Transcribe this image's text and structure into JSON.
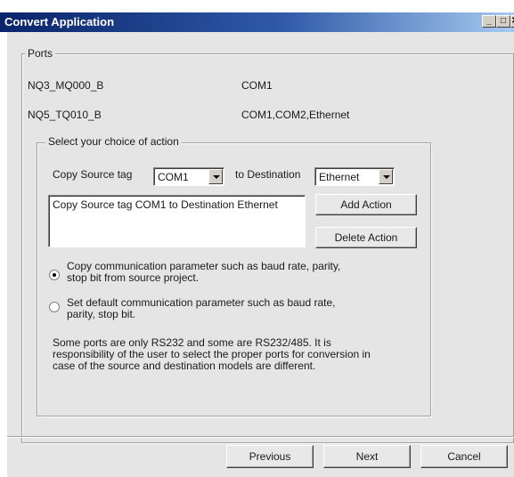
{
  "window": {
    "title": "Convert Application",
    "controls": {
      "minimize": "_",
      "maximize": "□",
      "close": "✕"
    }
  },
  "ports": {
    "legend": "Ports",
    "rows": [
      {
        "name": "NQ3_MQ000_B",
        "ports": "COM1"
      },
      {
        "name": "NQ5_TQ010_B",
        "ports": "COM1,COM2,Ethernet"
      }
    ]
  },
  "action_group": {
    "legend": "Select your choice of action",
    "source_label": "Copy Source tag",
    "source_value": "COM1",
    "destination_label": "to Destination",
    "destination_value": "Ethernet",
    "actions_list": [
      "Copy Source tag COM1 to Destination Ethernet"
    ],
    "add_button": "Add Action",
    "delete_button": "Delete Action",
    "options": [
      {
        "label_line1": "Copy communication parameter such as baud rate, parity,",
        "label_line2": "stop bit from source project.",
        "selected": true
      },
      {
        "label_line1": "Set default communication parameter such as baud rate,",
        "label_line2": "parity, stop bit.",
        "selected": false
      }
    ],
    "note_lines": [
      "Some ports are only RS232 and some are RS232/485. It is",
      "responsibility of the user to select the proper ports for conversion in",
      "case of the source and destination models are different."
    ]
  },
  "footer": {
    "previous": "Previous",
    "next": "Next",
    "cancel": "Cancel"
  },
  "colors": {
    "titlebar_start": "#0a246a",
    "titlebar_end": "#a6caf0",
    "panel": "#e5e5e5"
  }
}
